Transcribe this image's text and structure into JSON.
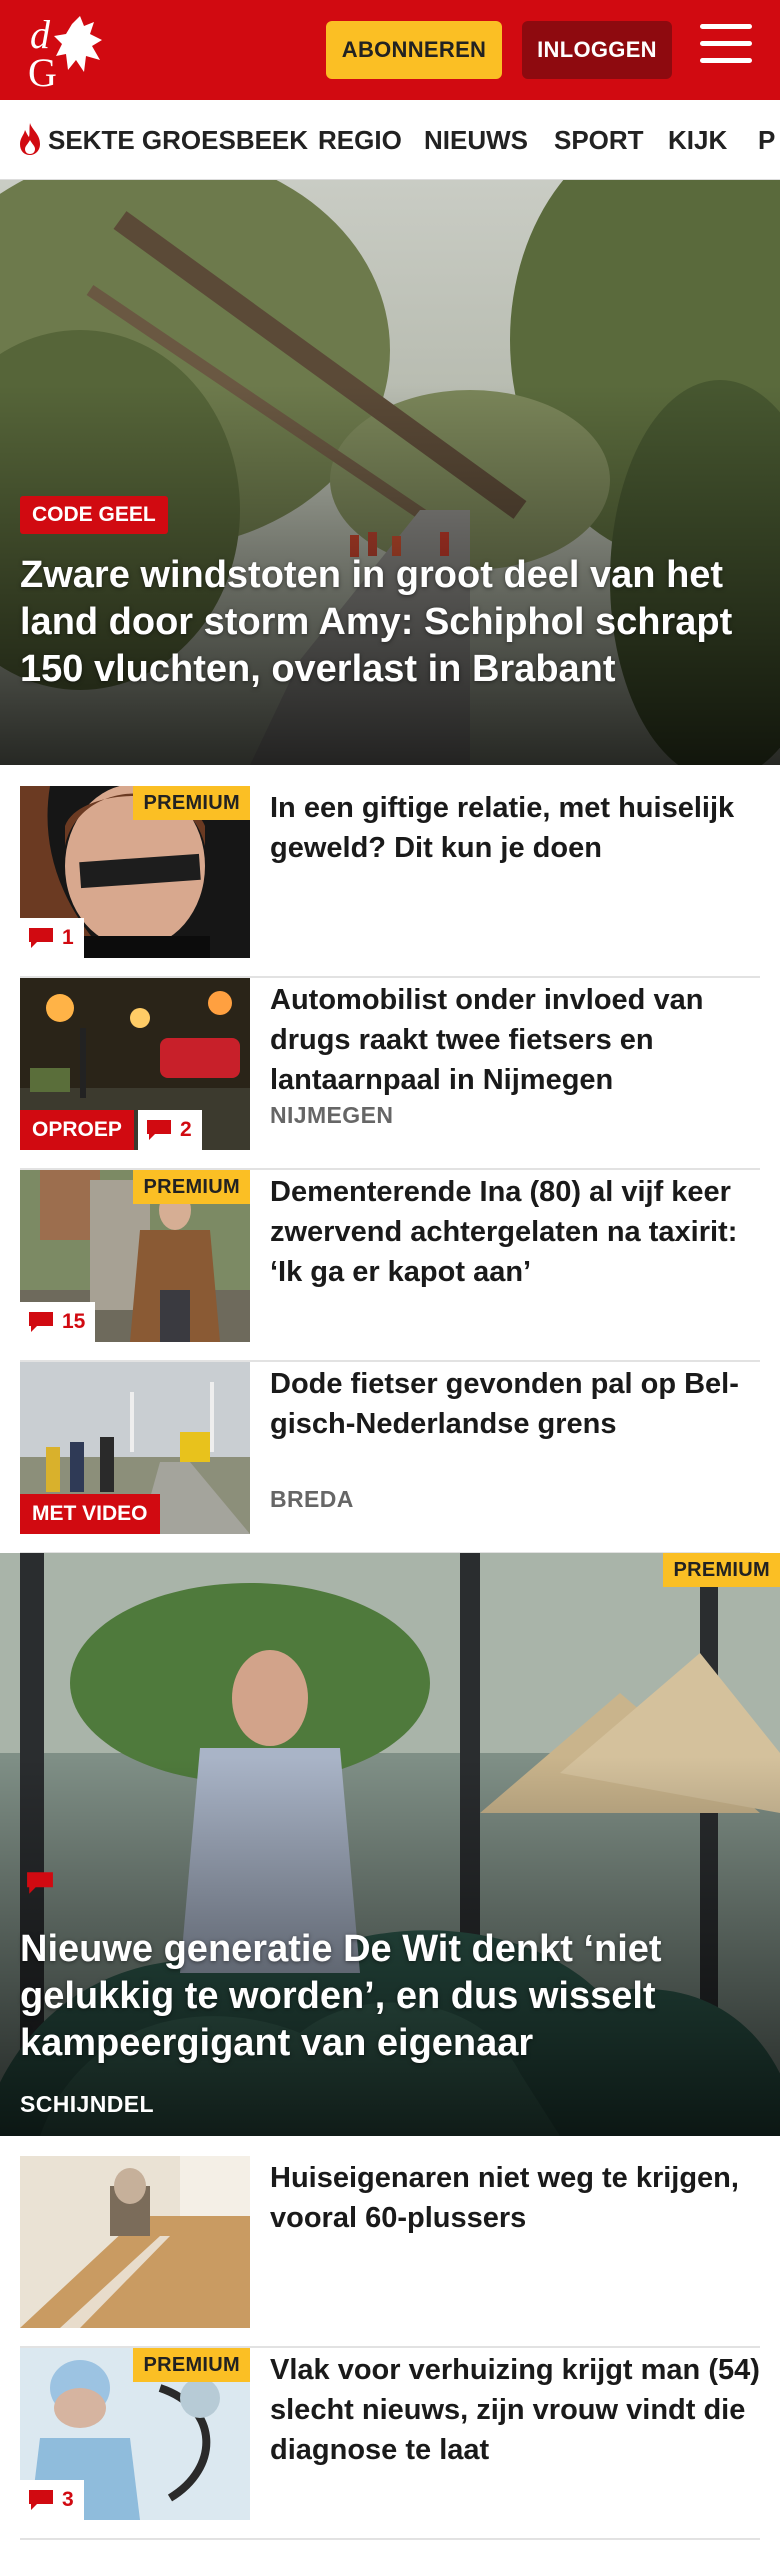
{
  "header": {
    "subscribe_label": "ABONNEREN",
    "login_label": "INLOGGEN",
    "brand_color": "#d10a11",
    "accent_color": "#fbbf24",
    "logo_letters": "dG"
  },
  "nav": {
    "items": [
      "SEKTE GROESBEEK",
      "REGIO",
      "NIEUWS",
      "SPORT",
      "KIJK",
      "P"
    ]
  },
  "hero": {
    "badge": "CODE GEEL",
    "title": "Zware windstoten in groot deel van het land door storm Amy: Schiphol schrapt 150 vluchten, overlast in Brabant"
  },
  "articles": [
    {
      "title": "In een giftige relatie, met huiselijk geweld? Dit kun je doen",
      "premium": "PREMIUM",
      "comments": "1"
    },
    {
      "title": "Automobilist onder invloed van drugs raakt twee fietsers en lantaarnpaal in Nijmegen",
      "location": "NIJMEGEN",
      "tag": "OPROEP",
      "comments": "2"
    },
    {
      "title": "Dementerende Ina (80) al vijf keer zwervend achtergelaten na taxirit: ‘Ik ga er kapot aan’",
      "premium": "PREMIUM",
      "comments": "15"
    },
    {
      "title": "Dode fietser gevonden pal op Bel-gisch-Nederlandse grens",
      "location": "BREDA",
      "tag": "MET VIDEO"
    }
  ],
  "feature": {
    "premium": "PREMIUM",
    "title": "Nieuwe generatie De Wit denkt ‘niet gelukkig te worden’, en dus wisselt kampeergigant van eigenaar",
    "location": "SCHIJNDEL"
  },
  "articles2": [
    {
      "title": "Huiseigenaren niet weg te krijgen, vooral 60-plussers"
    },
    {
      "title": "Vlak voor verhuizing krijgt man (54) slecht nieuws, zijn vrouw vindt die diagnose te laat",
      "premium": "PREMIUM",
      "comments": "3"
    }
  ]
}
